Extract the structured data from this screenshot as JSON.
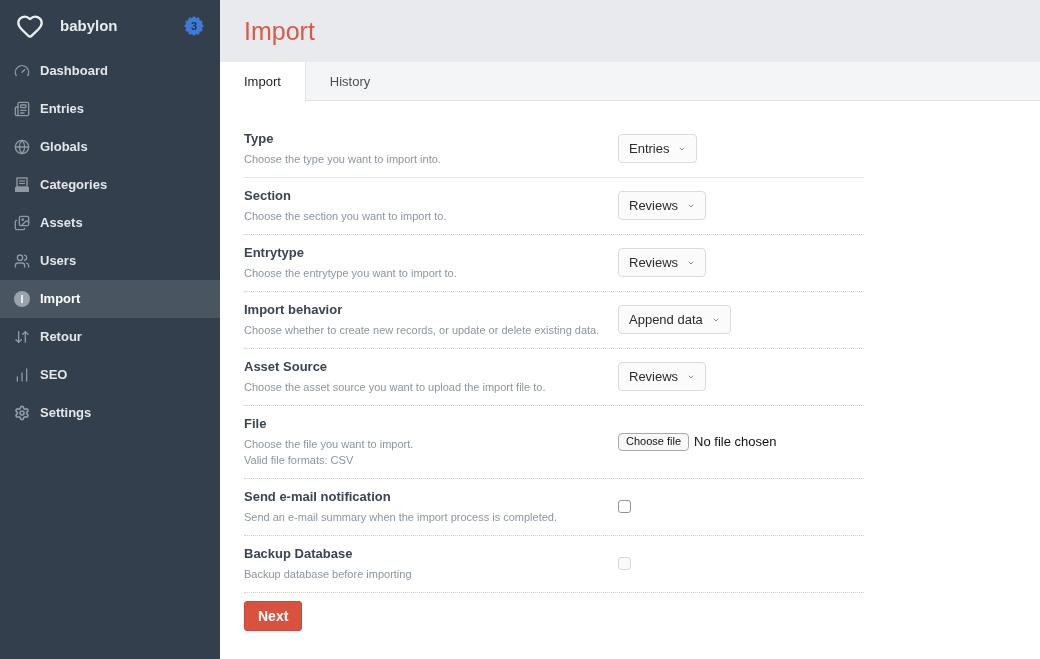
{
  "sidebar": {
    "brand": "babylon",
    "badge": "3",
    "items": [
      {
        "label": "Dashboard",
        "selected": false
      },
      {
        "label": "Entries",
        "selected": false
      },
      {
        "label": "Globals",
        "selected": false
      },
      {
        "label": "Categories",
        "selected": false
      },
      {
        "label": "Assets",
        "selected": false
      },
      {
        "label": "Users",
        "selected": false
      },
      {
        "label": "Import",
        "selected": true
      },
      {
        "label": "Retour",
        "selected": false
      },
      {
        "label": "SEO",
        "selected": false
      },
      {
        "label": "Settings",
        "selected": false
      }
    ]
  },
  "page": {
    "title": "Import"
  },
  "tabs": [
    {
      "label": "Import",
      "selected": true
    },
    {
      "label": "History",
      "selected": false
    }
  ],
  "fields": [
    {
      "kind": "select",
      "label": "Type",
      "description": [
        "Choose the type you want to import into."
      ],
      "value": "Entries"
    },
    {
      "kind": "select",
      "label": "Section",
      "description": [
        "Choose the section you want to import to."
      ],
      "value": "Reviews"
    },
    {
      "kind": "select",
      "label": "Entrytype",
      "description": [
        "Choose the entrytype you want to import to."
      ],
      "value": "Reviews"
    },
    {
      "kind": "select",
      "label": "Import behavior",
      "description": [
        "Choose whether to create new records, or update or delete existing data."
      ],
      "value": "Append data"
    },
    {
      "kind": "select",
      "label": "Asset Source",
      "description": [
        "Choose the asset source you want to upload the import file to."
      ],
      "value": "Reviews"
    },
    {
      "kind": "file",
      "label": "File",
      "description": [
        "Choose the file you want to import.",
        "Valid file formats: CSV"
      ],
      "button": "Choose file",
      "value": "No file chosen"
    },
    {
      "kind": "checkbox",
      "label": "Send e-mail notification",
      "description": [
        "Send an e-mail summary when the import process is completed."
      ],
      "checked": false,
      "disabled": false
    },
    {
      "kind": "checkbox",
      "label": "Backup Database",
      "description": [
        "Backup database before importing"
      ],
      "checked": false,
      "disabled": true
    }
  ],
  "submit": "Next"
}
